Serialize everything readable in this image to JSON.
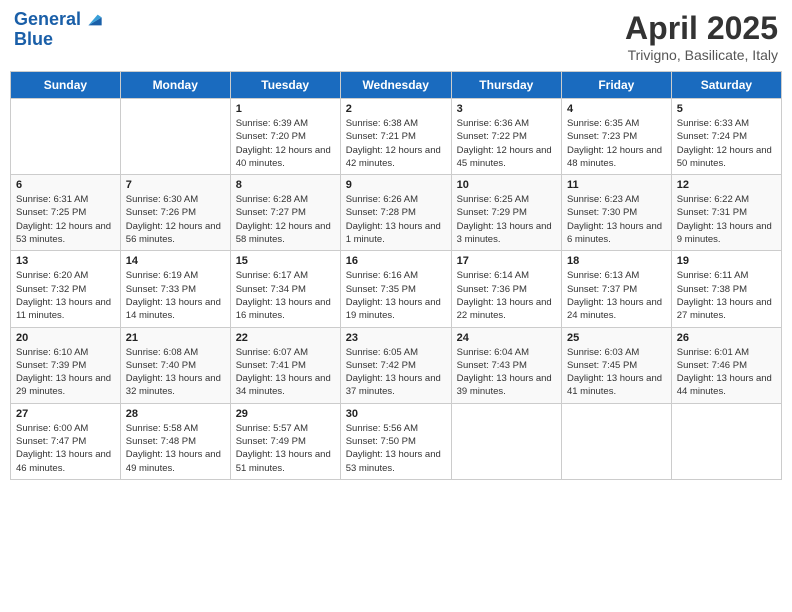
{
  "header": {
    "logo_line1": "General",
    "logo_line2": "Blue",
    "month": "April 2025",
    "location": "Trivigno, Basilicate, Italy"
  },
  "weekdays": [
    "Sunday",
    "Monday",
    "Tuesday",
    "Wednesday",
    "Thursday",
    "Friday",
    "Saturday"
  ],
  "weeks": [
    [
      {
        "day": "",
        "info": ""
      },
      {
        "day": "",
        "info": ""
      },
      {
        "day": "1",
        "info": "Sunrise: 6:39 AM\nSunset: 7:20 PM\nDaylight: 12 hours and 40 minutes."
      },
      {
        "day": "2",
        "info": "Sunrise: 6:38 AM\nSunset: 7:21 PM\nDaylight: 12 hours and 42 minutes."
      },
      {
        "day": "3",
        "info": "Sunrise: 6:36 AM\nSunset: 7:22 PM\nDaylight: 12 hours and 45 minutes."
      },
      {
        "day": "4",
        "info": "Sunrise: 6:35 AM\nSunset: 7:23 PM\nDaylight: 12 hours and 48 minutes."
      },
      {
        "day": "5",
        "info": "Sunrise: 6:33 AM\nSunset: 7:24 PM\nDaylight: 12 hours and 50 minutes."
      }
    ],
    [
      {
        "day": "6",
        "info": "Sunrise: 6:31 AM\nSunset: 7:25 PM\nDaylight: 12 hours and 53 minutes."
      },
      {
        "day": "7",
        "info": "Sunrise: 6:30 AM\nSunset: 7:26 PM\nDaylight: 12 hours and 56 minutes."
      },
      {
        "day": "8",
        "info": "Sunrise: 6:28 AM\nSunset: 7:27 PM\nDaylight: 12 hours and 58 minutes."
      },
      {
        "day": "9",
        "info": "Sunrise: 6:26 AM\nSunset: 7:28 PM\nDaylight: 13 hours and 1 minute."
      },
      {
        "day": "10",
        "info": "Sunrise: 6:25 AM\nSunset: 7:29 PM\nDaylight: 13 hours and 3 minutes."
      },
      {
        "day": "11",
        "info": "Sunrise: 6:23 AM\nSunset: 7:30 PM\nDaylight: 13 hours and 6 minutes."
      },
      {
        "day": "12",
        "info": "Sunrise: 6:22 AM\nSunset: 7:31 PM\nDaylight: 13 hours and 9 minutes."
      }
    ],
    [
      {
        "day": "13",
        "info": "Sunrise: 6:20 AM\nSunset: 7:32 PM\nDaylight: 13 hours and 11 minutes."
      },
      {
        "day": "14",
        "info": "Sunrise: 6:19 AM\nSunset: 7:33 PM\nDaylight: 13 hours and 14 minutes."
      },
      {
        "day": "15",
        "info": "Sunrise: 6:17 AM\nSunset: 7:34 PM\nDaylight: 13 hours and 16 minutes."
      },
      {
        "day": "16",
        "info": "Sunrise: 6:16 AM\nSunset: 7:35 PM\nDaylight: 13 hours and 19 minutes."
      },
      {
        "day": "17",
        "info": "Sunrise: 6:14 AM\nSunset: 7:36 PM\nDaylight: 13 hours and 22 minutes."
      },
      {
        "day": "18",
        "info": "Sunrise: 6:13 AM\nSunset: 7:37 PM\nDaylight: 13 hours and 24 minutes."
      },
      {
        "day": "19",
        "info": "Sunrise: 6:11 AM\nSunset: 7:38 PM\nDaylight: 13 hours and 27 minutes."
      }
    ],
    [
      {
        "day": "20",
        "info": "Sunrise: 6:10 AM\nSunset: 7:39 PM\nDaylight: 13 hours and 29 minutes."
      },
      {
        "day": "21",
        "info": "Sunrise: 6:08 AM\nSunset: 7:40 PM\nDaylight: 13 hours and 32 minutes."
      },
      {
        "day": "22",
        "info": "Sunrise: 6:07 AM\nSunset: 7:41 PM\nDaylight: 13 hours and 34 minutes."
      },
      {
        "day": "23",
        "info": "Sunrise: 6:05 AM\nSunset: 7:42 PM\nDaylight: 13 hours and 37 minutes."
      },
      {
        "day": "24",
        "info": "Sunrise: 6:04 AM\nSunset: 7:43 PM\nDaylight: 13 hours and 39 minutes."
      },
      {
        "day": "25",
        "info": "Sunrise: 6:03 AM\nSunset: 7:45 PM\nDaylight: 13 hours and 41 minutes."
      },
      {
        "day": "26",
        "info": "Sunrise: 6:01 AM\nSunset: 7:46 PM\nDaylight: 13 hours and 44 minutes."
      }
    ],
    [
      {
        "day": "27",
        "info": "Sunrise: 6:00 AM\nSunset: 7:47 PM\nDaylight: 13 hours and 46 minutes."
      },
      {
        "day": "28",
        "info": "Sunrise: 5:58 AM\nSunset: 7:48 PM\nDaylight: 13 hours and 49 minutes."
      },
      {
        "day": "29",
        "info": "Sunrise: 5:57 AM\nSunset: 7:49 PM\nDaylight: 13 hours and 51 minutes."
      },
      {
        "day": "30",
        "info": "Sunrise: 5:56 AM\nSunset: 7:50 PM\nDaylight: 13 hours and 53 minutes."
      },
      {
        "day": "",
        "info": ""
      },
      {
        "day": "",
        "info": ""
      },
      {
        "day": "",
        "info": ""
      }
    ]
  ]
}
